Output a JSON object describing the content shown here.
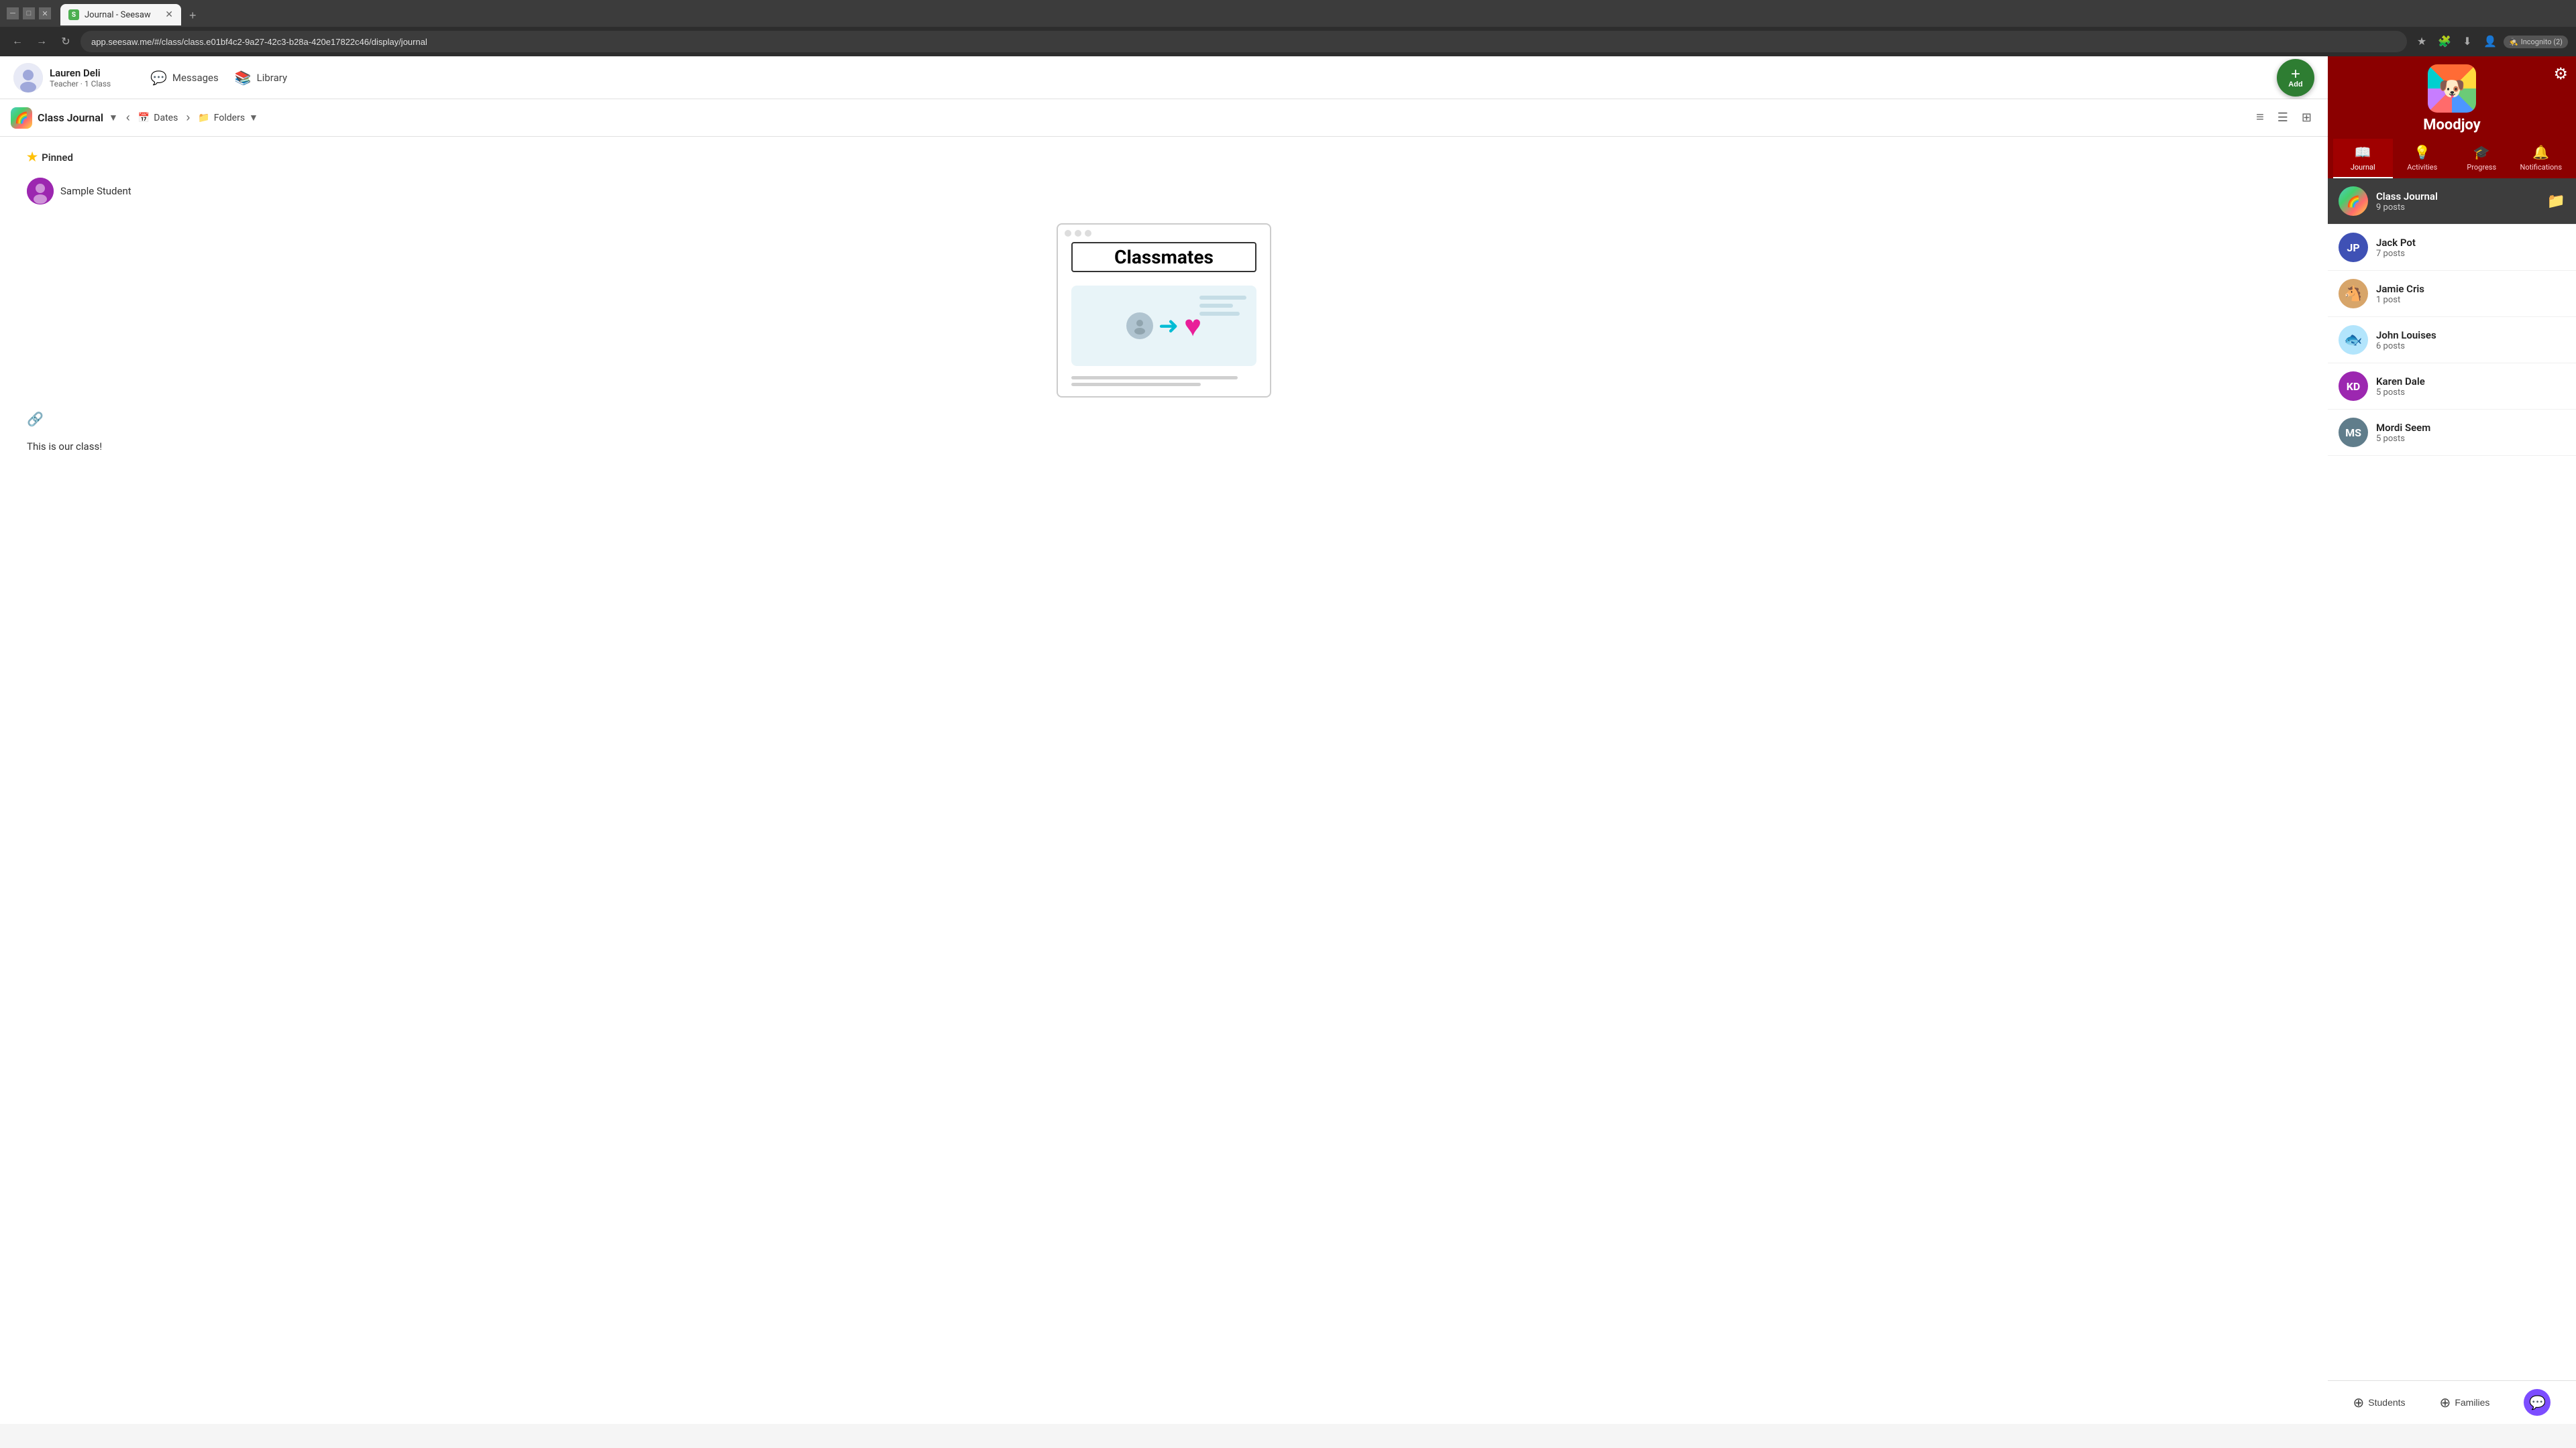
{
  "browser": {
    "tab_title": "Journal - Seesaw",
    "tab_favicon": "S",
    "url": "app.seesaw.me/#/class/class.e01bf4c2-9a27-42c3-b28a-420e17822c46/display/journal",
    "incognito_label": "Incognito (2)"
  },
  "nav": {
    "user_name": "Lauren Deli",
    "user_role": "Teacher · 1 Class",
    "messages_label": "Messages",
    "library_label": "Library",
    "add_label": "Add"
  },
  "moodjoy": {
    "title": "Moodjoy",
    "tabs": [
      {
        "id": "journal",
        "label": "Journal",
        "icon": "📖",
        "active": true
      },
      {
        "id": "activities",
        "label": "Activities",
        "icon": "💡",
        "active": false
      },
      {
        "id": "progress",
        "label": "Progress",
        "icon": "🎓",
        "active": false
      },
      {
        "id": "notifications",
        "label": "Notifications",
        "icon": "🔔",
        "active": false
      }
    ]
  },
  "sub_nav": {
    "class_name": "Class Journal",
    "dates_label": "Dates",
    "folders_label": "Folders"
  },
  "pinned": {
    "label": "Pinned",
    "student_name": "Sample Student"
  },
  "classmates_card": {
    "title": "Classmates"
  },
  "caption": "This is our class!",
  "sidebar": {
    "tabs": [
      {
        "id": "journal",
        "label": "Journal",
        "icon": "📖",
        "active": true
      },
      {
        "id": "activities",
        "label": "Activities",
        "icon": "💡",
        "active": false
      },
      {
        "id": "progress",
        "label": "Progress",
        "icon": "🎓",
        "active": false
      },
      {
        "id": "notifications",
        "label": "Notifications",
        "icon": "🔔",
        "active": false
      }
    ],
    "class_journal_posts_label": "Class Journal posts",
    "students": [
      {
        "id": "class-journal",
        "name": "Class Journal",
        "posts": "9 posts",
        "color": "linear-gradient(135deg,#4ecdc4,#44cf6c,#ff6b6b,#ffd93d)",
        "type": "image",
        "active": true
      },
      {
        "id": "jack-pot",
        "name": "Jack Pot",
        "posts": "7 posts",
        "initials": "JP",
        "color": "#3f51b5",
        "active": false
      },
      {
        "id": "jamie-cris",
        "name": "Jamie Cris",
        "posts": "1 post",
        "type": "horse",
        "color": "#a0522d",
        "active": false
      },
      {
        "id": "john-louises",
        "name": "John Louises",
        "posts": "6 posts",
        "type": "fish",
        "color": "#4fc3f7",
        "active": false
      },
      {
        "id": "karen-dale",
        "name": "Karen Dale",
        "posts": "5 posts",
        "initials": "KD",
        "color": "#9c27b0",
        "active": false
      },
      {
        "id": "mordi-seem",
        "name": "Mordi Seem",
        "posts": "5 posts",
        "initials": "MS",
        "color": "#607d8b",
        "active": false
      }
    ],
    "students_label": "Students",
    "families_label": "Families"
  }
}
